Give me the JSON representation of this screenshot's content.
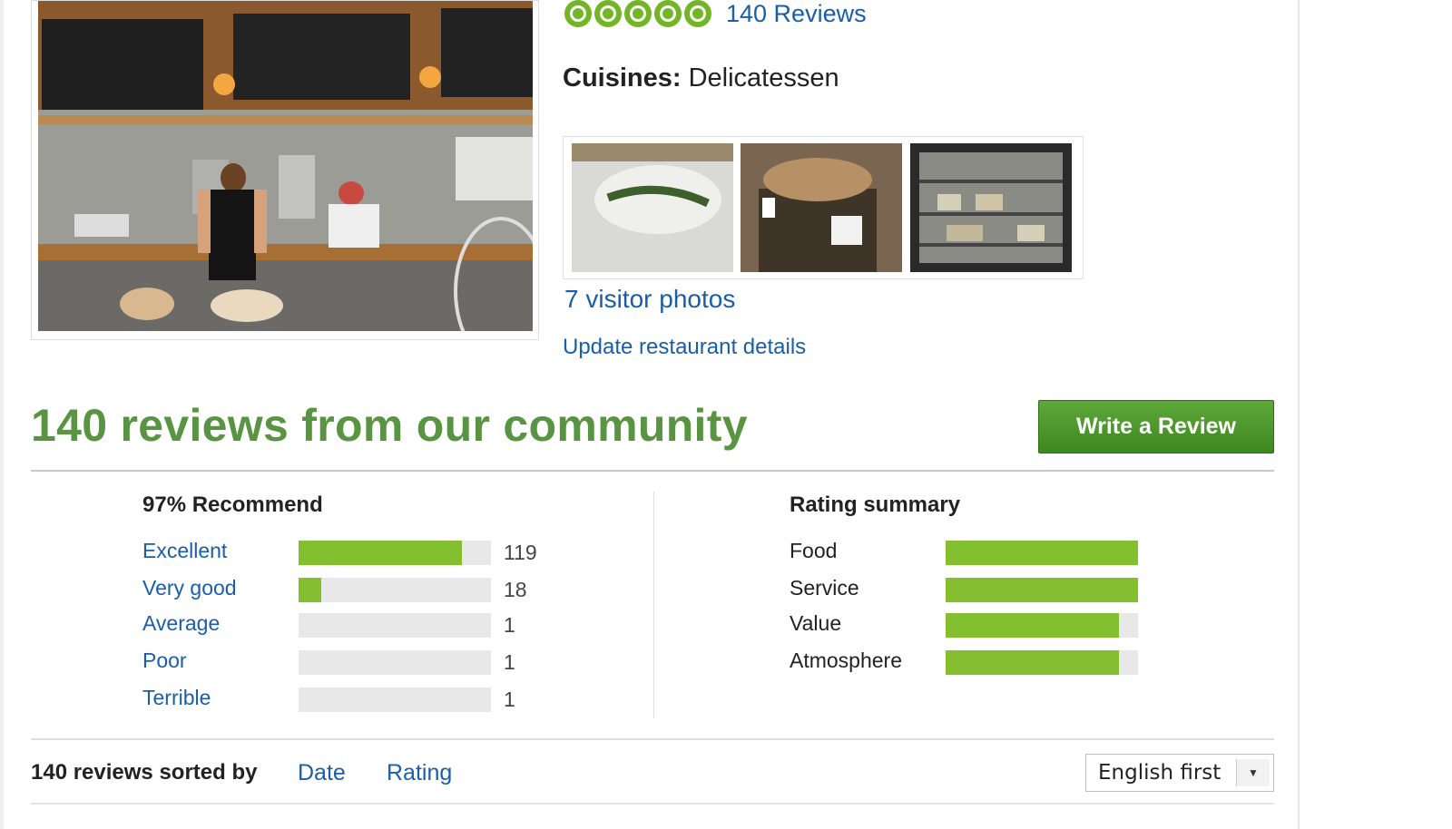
{
  "rating": {
    "bubbles": 5,
    "reviews_link": "140 Reviews"
  },
  "cuisines": {
    "label": "Cuisines:",
    "value": "Delicatessen"
  },
  "photos": {
    "visitor_photos_link": "7 visitor photos",
    "update_link": "Update restaurant details"
  },
  "reviews": {
    "title": "140 reviews from our community",
    "write_button": "Write a Review",
    "recommend_title": "97% Recommend",
    "distribution": [
      {
        "label": "Excellent",
        "count": "119",
        "fraction": 0.85
      },
      {
        "label": "Very good",
        "count": "18",
        "fraction": 0.12
      },
      {
        "label": "Average",
        "count": "1",
        "fraction": 0.0
      },
      {
        "label": "Poor",
        "count": "1",
        "fraction": 0.0
      },
      {
        "label": "Terrible",
        "count": "1",
        "fraction": 0.0
      }
    ],
    "summary_title": "Rating summary",
    "summary": [
      {
        "label": "Food",
        "fraction": 1.0
      },
      {
        "label": "Service",
        "fraction": 1.0
      },
      {
        "label": "Value",
        "fraction": 0.9
      },
      {
        "label": "Atmosphere",
        "fraction": 0.9
      }
    ]
  },
  "sort": {
    "label": "140 reviews sorted by",
    "date": "Date",
    "rating": "Rating",
    "language": "English first"
  },
  "colors": {
    "accent_green": "#589442",
    "bar_green": "#83bf2e",
    "link_blue": "#1a5ea8"
  }
}
